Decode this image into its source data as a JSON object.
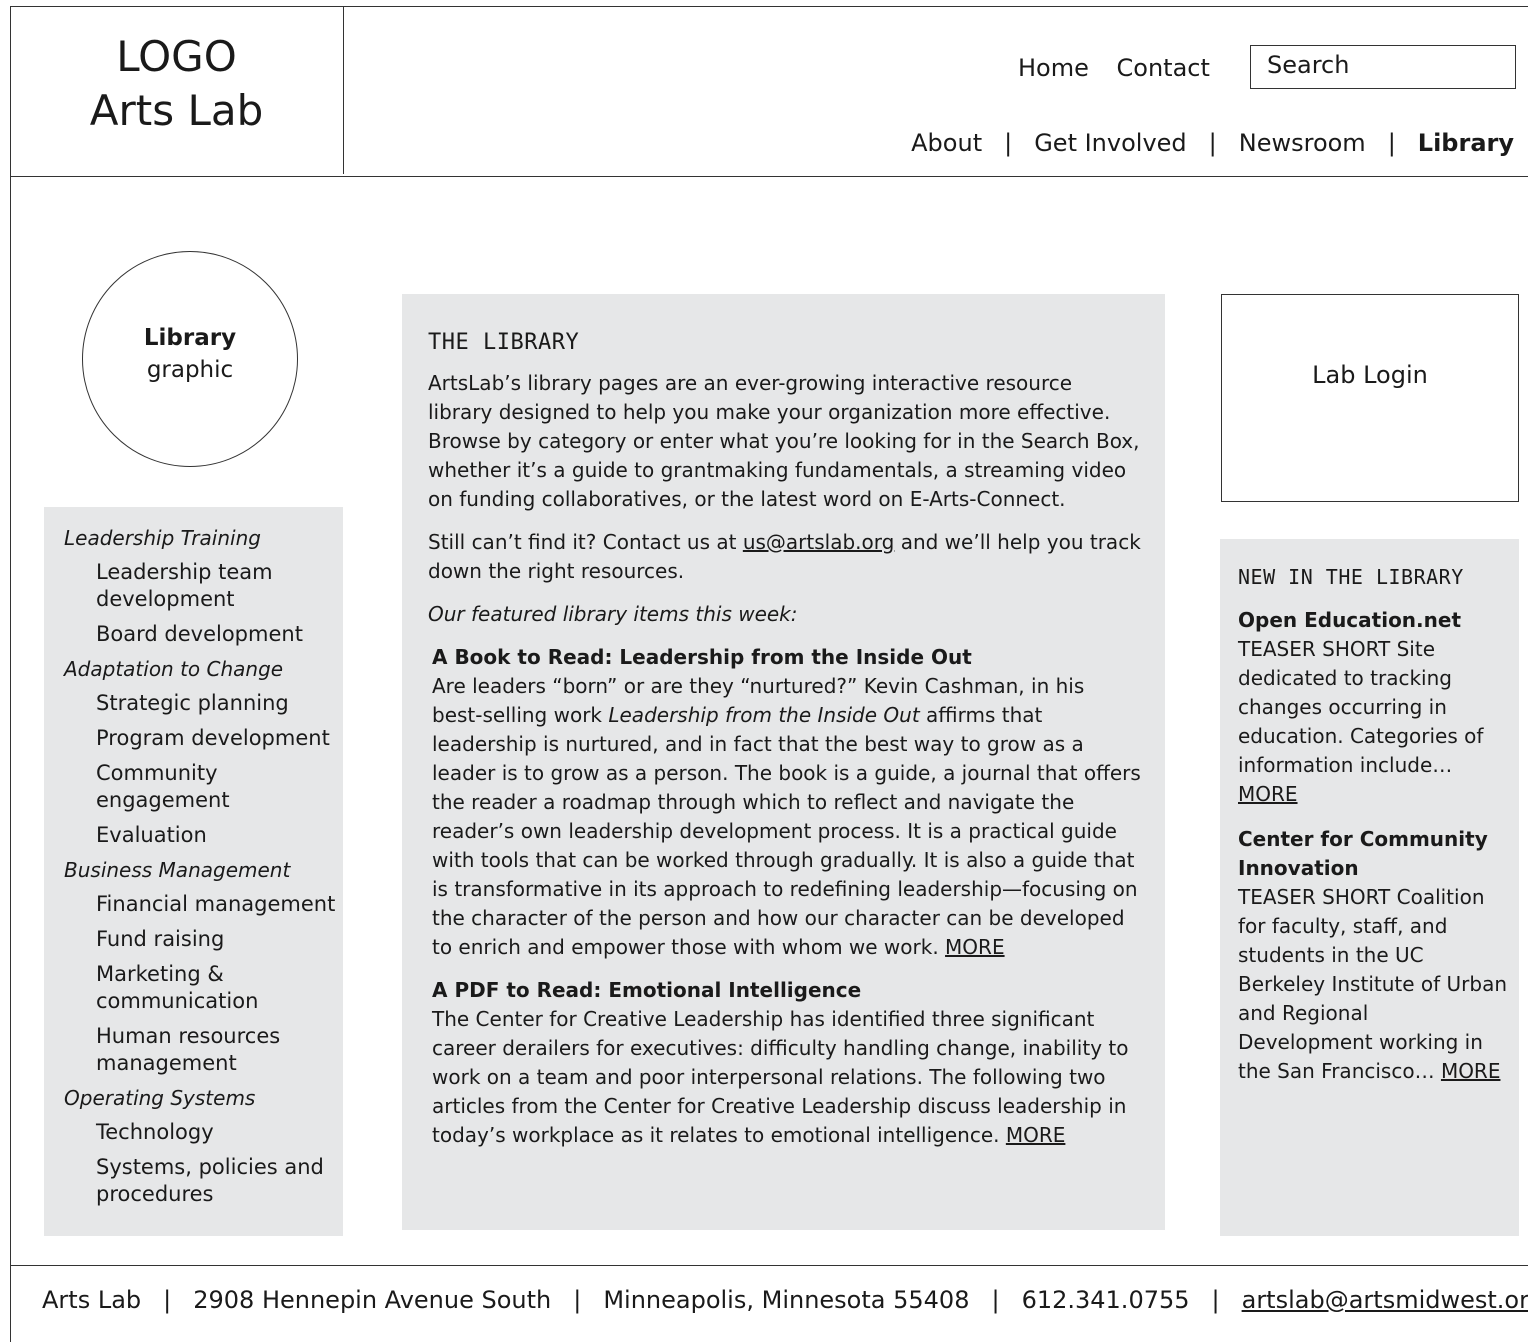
{
  "logo": {
    "line1": "LOGO",
    "line2": "Arts Lab"
  },
  "utility_nav": {
    "home": "Home",
    "contact": "Contact"
  },
  "search": {
    "placeholder": "Search"
  },
  "main_nav": {
    "about": "About",
    "get_involved": "Get Involved",
    "newsroom": "Newsroom",
    "library": "Library",
    "separator": "|"
  },
  "graphic": {
    "bold": "Library",
    "text": "graphic"
  },
  "sidebar": {
    "groups": [
      {
        "label": "Leadership Training",
        "items": [
          "Leadership team development",
          "Board development"
        ]
      },
      {
        "label": "Adaptation to Change",
        "items": [
          "Strategic planning",
          "Program development",
          "Community engagement",
          "Evaluation"
        ]
      },
      {
        "label": "Business Management",
        "items": [
          "Financial management",
          "Fund raising",
          "Marketing & communication",
          "Human resources management"
        ]
      },
      {
        "label": "Operating Systems",
        "items": [
          "Technology",
          "Systems, policies and procedures"
        ]
      }
    ]
  },
  "content": {
    "title": "THE LIBRARY",
    "intro": "ArtsLab’s library pages are an ever-growing interactive resource library designed to help you make your organization more effective. Browse by category or enter what you’re looking for in the Search Box, whether it’s a guide to grantmaking fundamentals, a streaming video on funding collaboratives, or the latest word on E-Arts-Connect.",
    "contact_pre": "Still can’t find it? Contact us at ",
    "contact_email": "us@artslab.org",
    "contact_post": " and we’ll help you track down the right resources.",
    "featured_label": "Our featured library items this week:",
    "item1_title": "A Book to Read: Leadership from the Inside Out",
    "item1_pre": "Are leaders “born” or are they “nurtured?”  Kevin Cashman, in his best-selling work ",
    "item1_italic": "Leadership from the Inside Out",
    "item1_post": " affirms that leadership is nurtured, and in fact that the best way to grow as a leader is to grow as a person.  The book is a guide, a journal that offers the reader a roadmap through which to reflect and navigate the reader’s own leadership development process.  It is a practical guide with tools that can be worked through gradually.  It is also a guide that is transformative in its approach to redefining leadership—focusing on the character of the person and how our character can be developed to enrich and empower those with whom we work.  ",
    "item1_more": "MORE",
    "item2_title": "A PDF to Read: Emotional Intelligence",
    "item2_body": "The Center for Creative Leadership has identified three significant career derailers for executives: difficulty handling change, inability to work on a team and poor interpersonal relations.  The following two articles from the Center for Creative Leadership discuss leadership in today’s workplace as it relates to emotional intelligence.  ",
    "item2_more": "MORE"
  },
  "login": {
    "label": "Lab Login"
  },
  "new_library": {
    "title": "NEW IN THE LIBRARY",
    "entry1_title": "Open Education.net",
    "entry1_body": "TEASER SHORT Site dedicated to tracking changes occurring in education. Categories of information include… ",
    "entry1_more": "MORE",
    "entry2_title": "Center for Community Innovation",
    "entry2_body": "TEASER SHORT Coalition for faculty, staff, and students in the UC Berkeley Institute of Urban and Regional Development working in the San Francisco… ",
    "entry2_more": "MORE"
  },
  "footer": {
    "name": "Arts Lab",
    "address": "2908 Hennepin Avenue South",
    "city": "Minneapolis, Minnesota  55408",
    "phone": "612.341.0755",
    "email": "artslab@artsmidwest.org",
    "separator": "|"
  }
}
